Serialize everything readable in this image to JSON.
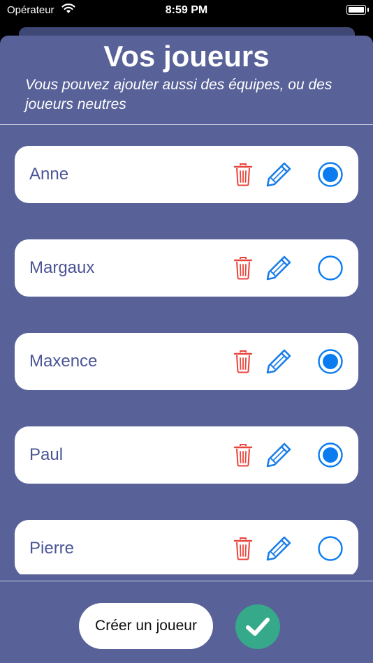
{
  "status_bar": {
    "carrier": "Opérateur",
    "time": "8:59 PM"
  },
  "header": {
    "title": "Vos joueurs",
    "subtitle": "Vous pouvez ajouter aussi des équipes, ou des joueurs neutres"
  },
  "players": [
    {
      "name": "Anne",
      "selected": true
    },
    {
      "name": "Margaux",
      "selected": false
    },
    {
      "name": "Maxence",
      "selected": true
    },
    {
      "name": "Paul",
      "selected": true
    },
    {
      "name": "Pierre",
      "selected": false
    }
  ],
  "footer": {
    "create_label": "Créer un joueur"
  },
  "colors": {
    "sheet": "#586198",
    "trash": "#e8453c",
    "edit": "#1a7ee6",
    "radio": "#0a7cf0",
    "confirm": "#35a98a",
    "name_text": "#4b5596"
  }
}
